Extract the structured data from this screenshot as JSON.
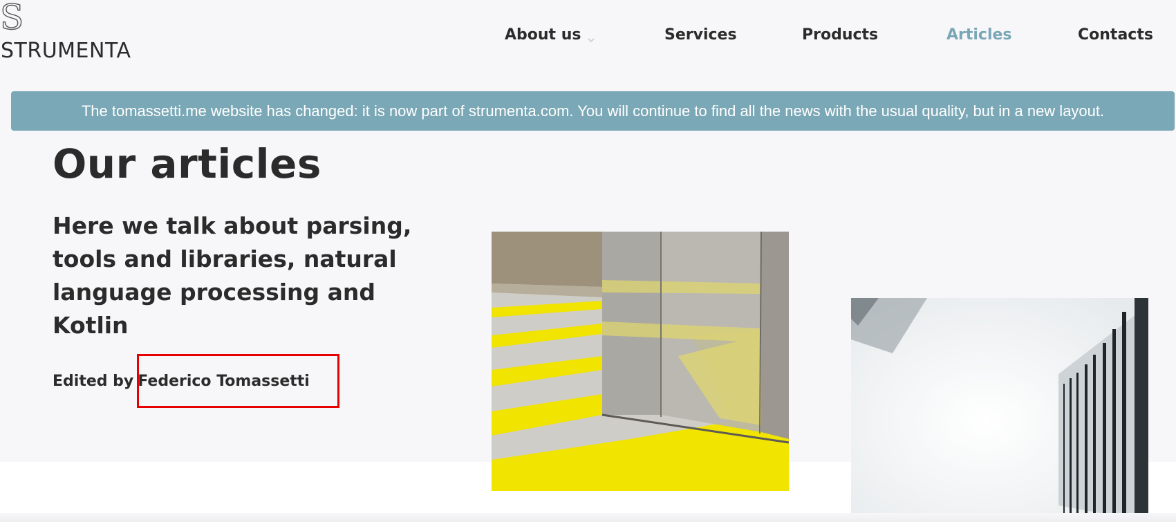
{
  "brand": {
    "logo_letter": "S",
    "name": "STRUMENTA"
  },
  "nav": {
    "items": [
      {
        "label": "About us",
        "has_dropdown": true,
        "active": false
      },
      {
        "label": "Services",
        "active": false
      },
      {
        "label": "Products",
        "active": false
      },
      {
        "label": "Articles",
        "active": true
      },
      {
        "label": "Contacts",
        "active": false
      }
    ]
  },
  "banner": {
    "text": "The tomassetti.me website has changed: it is now part of strumenta.com. You will continue to find all the news with the usual quality, but in a new layout."
  },
  "hero": {
    "title": "Our articles",
    "tagline": "Here we talk about parsing, tools and libraries, natural language processing and Kotlin",
    "edited_by_label": "Edited by",
    "author": "Federico Tomassetti"
  },
  "colors": {
    "accent": "#7ba8b6",
    "active_nav": "#7aa7b5",
    "text": "#2b2b2b",
    "highlight": "#e60000",
    "hero_background": "#f7f7f9"
  },
  "icons": {
    "dropdown": "chevron-down-icon"
  }
}
